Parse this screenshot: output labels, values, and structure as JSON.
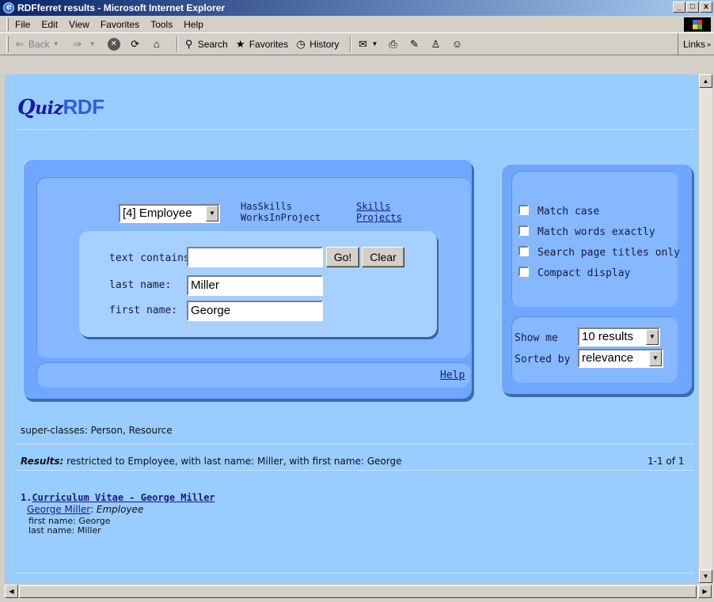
{
  "window": {
    "title": "RDFferret results - Microsoft Internet Explorer",
    "min": "_",
    "max": "□",
    "close": "x"
  },
  "menu": [
    "File",
    "Edit",
    "View",
    "Favorites",
    "Tools",
    "Help"
  ],
  "toolbar": {
    "back": "Back",
    "search": "Search",
    "favorites": "Favorites",
    "history": "History",
    "links": "Links"
  },
  "page": {
    "logo_q": "Q",
    "logo_uiz": "uiz",
    "logo_rdf": "RDF",
    "class_select": "[4] Employee",
    "properties": [
      "HasSkills",
      "WorksInProject"
    ],
    "related_links": [
      "Skills",
      "Projects"
    ],
    "fields": {
      "text_contains_label": "text contains:",
      "text_contains_value": "",
      "last_name_label": "last name:",
      "last_name_value": "Miller",
      "first_name_label": "first name:",
      "first_name_value": "George"
    },
    "go_button": "Go!",
    "clear_button": "Clear",
    "help_link": "Help",
    "options": {
      "match_case": "Match case",
      "match_words": "Match words exactly",
      "titles_only": "Search page titles only",
      "compact": "Compact display"
    },
    "show_me_label": "Show me",
    "show_me_value": "10 results",
    "sorted_by_label": "Sorted by",
    "sorted_by_value": "relevance",
    "superclasses": "super-classes: Person, Resource",
    "results_label": "Results:",
    "results_summary": " restricted to Employee, with last name: Miller, with first name: George",
    "results_count": "1-1 of 1",
    "result": {
      "number": "1.",
      "title": "Curriculum Vitae - George Miller",
      "entity": "George Miller",
      "entity_type": "Employee",
      "first_name_line": "first name: George",
      "last_name_line": "last name: Miller"
    }
  }
}
